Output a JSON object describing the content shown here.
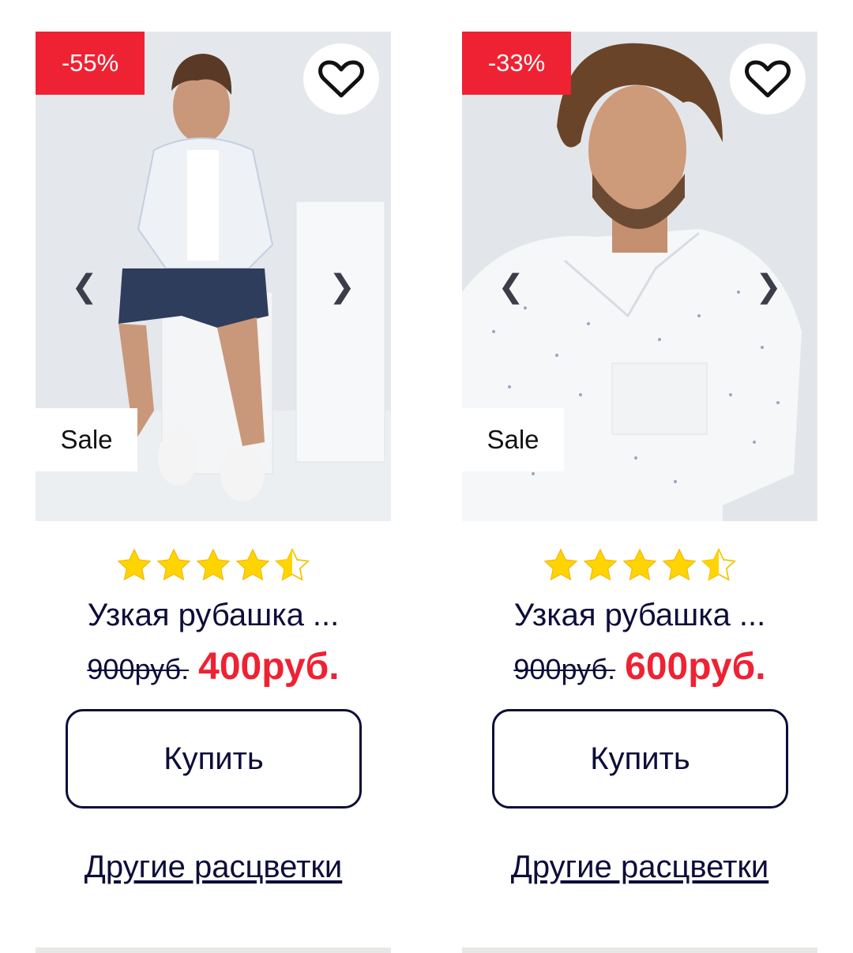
{
  "products": [
    {
      "discount": "-55%",
      "badge": "Sale",
      "rating": 4.5,
      "name": "Узкая рубашка ...",
      "old_price": "900руб.",
      "new_price": "400руб.",
      "buy_label": "Купить",
      "colors_link": "Другие расцветки",
      "prev_arrow": "❮",
      "next_arrow": "❯"
    },
    {
      "discount": "-33%",
      "badge": "Sale",
      "rating": 4.5,
      "name": "Узкая рубашка ...",
      "old_price": "900руб.",
      "new_price": "600руб.",
      "buy_label": "Купить",
      "colors_link": "Другие расцветки",
      "prev_arrow": "❮",
      "next_arrow": "❯"
    }
  ],
  "icons": {
    "favorite": "heart-outline-icon",
    "star": "star-icon"
  },
  "colors": {
    "accent": "#ee2233",
    "text": "#0d0d3a",
    "star": "#ffd400"
  }
}
